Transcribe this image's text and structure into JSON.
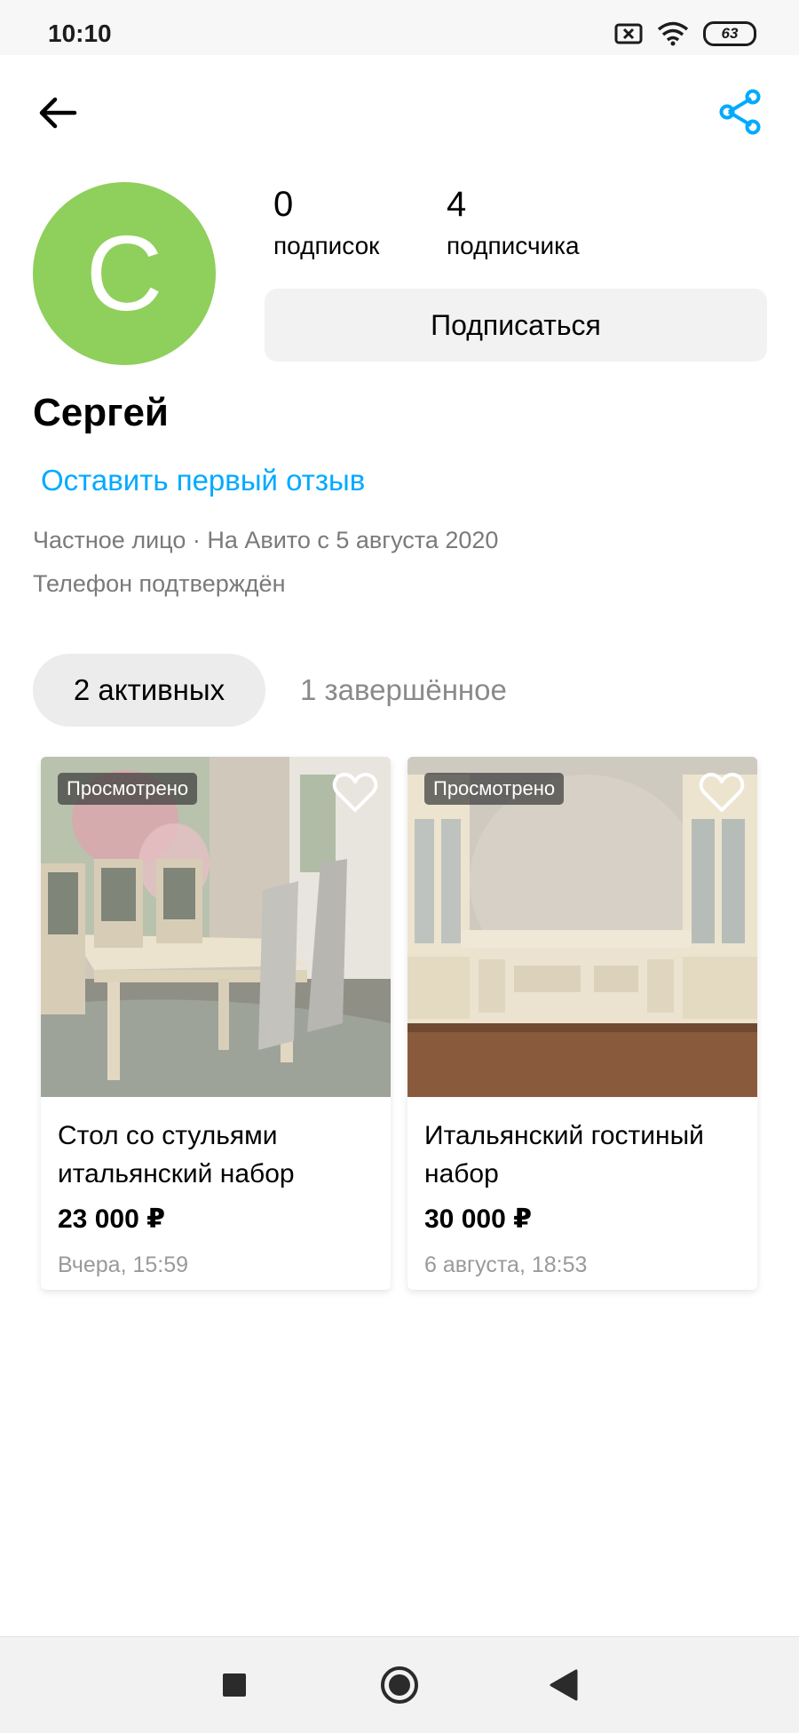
{
  "status_bar": {
    "time": "10:10",
    "battery": "63"
  },
  "profile": {
    "avatar_letter": "С",
    "name": "Сергей",
    "subscriptions_count": "0",
    "subscriptions_label": "подписок",
    "followers_count": "4",
    "followers_label": "подписчика",
    "subscribe_label": "Подписаться",
    "review_link": "Оставить первый отзыв",
    "meta_line": "Частное лицо · На Авито с 5 августа 2020",
    "phone_status": "Телефон подтверждён"
  },
  "tabs": [
    {
      "label": "2 активных",
      "active": true
    },
    {
      "label": "1 завершённое",
      "active": false
    }
  ],
  "listings": [
    {
      "badge": "Просмотрено",
      "title": "Стол со стульями итальянский набор",
      "price": "23 000 ₽",
      "date": "Вчера, 15:59"
    },
    {
      "badge": "Просмотрено",
      "title": "Итальянский гостиный набор",
      "price": "30 000 ₽",
      "date": "6 августа, 18:53"
    }
  ],
  "colors": {
    "accent": "#00aaff",
    "avatar_bg": "#8fcf5c",
    "secondary_text": "#7a7a7a"
  },
  "icons": {
    "back": "arrow-left-icon",
    "share": "share-icon",
    "favorite": "heart-outline-icon",
    "nav_recent": "square-icon",
    "nav_home": "circle-icon",
    "nav_back": "triangle-back-icon"
  }
}
